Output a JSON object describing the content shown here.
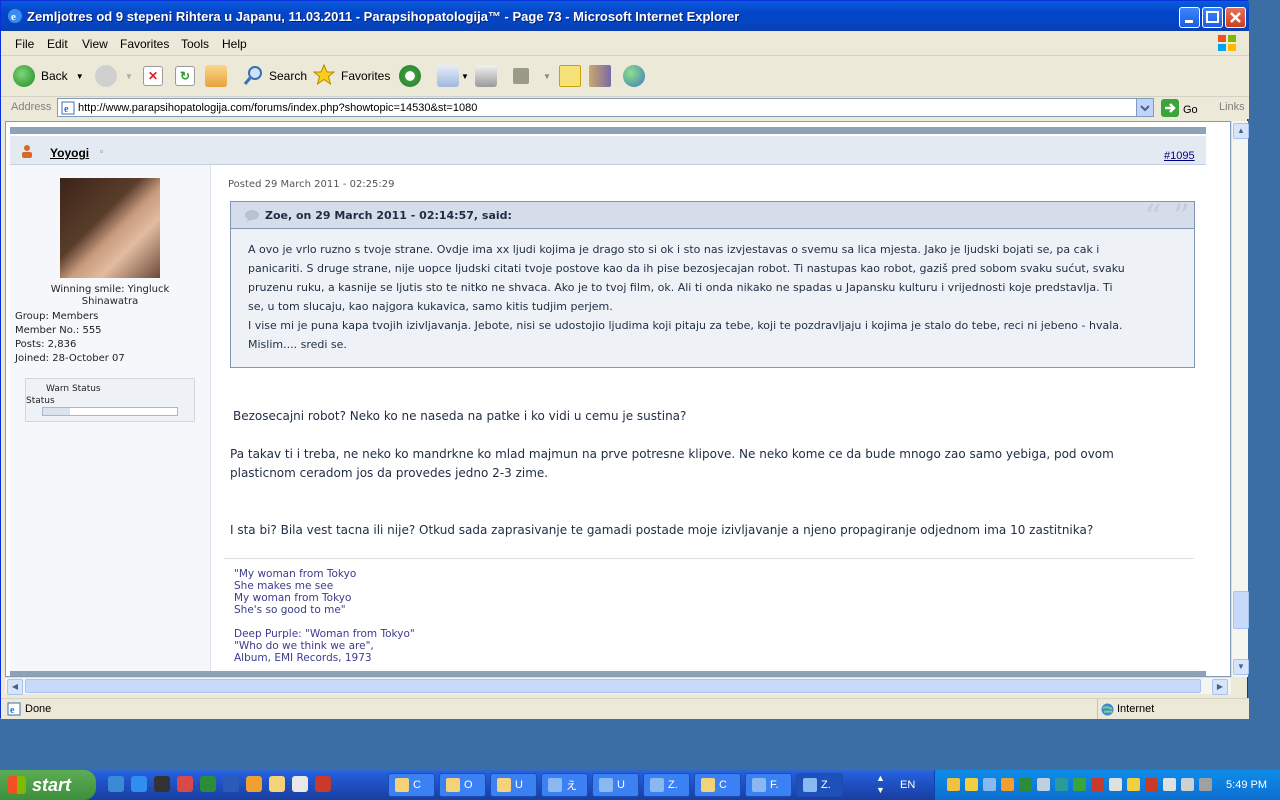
{
  "window": {
    "title": "Zemljotres od 9 stepeni Rihtera u Japanu, 11.03.2011 - Parapsihopatologija™ - Page 73 - Microsoft Internet Explorer"
  },
  "menu": [
    "File",
    "Edit",
    "View",
    "Favorites",
    "Tools",
    "Help"
  ],
  "toolbar": {
    "back": "Back",
    "search": "Search",
    "favorites": "Favorites"
  },
  "address": {
    "label": "Address",
    "url": "http://www.parapsihopatologija.com/forums/index.php?showtopic=14530&st=1080",
    "go": "Go",
    "links": "Links"
  },
  "post": {
    "username": "Yoyogi",
    "number": "#1095",
    "posted": "Posted 29 March 2011 - 02:25:29",
    "avatar_caption": "Winning smile: Yingluck Shinawatra",
    "group": "Group:  Members",
    "member_no": "Member No.:  555",
    "posts": "Posts:  2,836",
    "joined": "Joined:  28-October 07",
    "warn_label": "Warn Status",
    "status_label": "Status",
    "warn_level": 0.2,
    "quote_header": "Zoe, on 29 March 2011 - 02:14:57, said:",
    "quote_lines": [
      "A ovo je vrlo ruzno s tvoje strane. Ovdje ima xx ljudi kojima je drago sto si ok i sto nas izvjestavas o svemu sa lica mjesta. Jako je ljudski bojati se, pa cak i",
      "panicariti. S druge strane, nije uopce ljudski citati tvoje postove kao da ih pise bezosjecajan robot. Ti nastupas kao robot, gaziš pred sobom svaku sućut, svaku",
      "pruzenu ruku, a kasnije se ljutis sto te nitko ne shvaca. Ako je to tvoj film, ok. Ali ti onda nikako ne spadas u Japansku kulturu i vrijednosti koje predstavlja. Ti",
      "se, u tom slucaju, kao najgora kukavica, samo kitis tudjim perjem.",
      "I vise mi je puna kapa tvojih izivljavanja. Jebote, nisi se udostojio ljudima koji pitaju za tebe, koji te pozdravljaju i kojima je stalo do tebe, reci ni jebeno - hvala.",
      "Mislim.... sredi se."
    ],
    "body1": "Bezosecajni robot? Neko ko ne naseda na patke i ko vidi u cemu je sustina?",
    "body2a": "Pa takav ti i treba, ne neko ko mandrkne ko mlad majmun na prve potresne klipove. Ne neko kome ce da bude mnogo zao samo yebiga, pod ovom",
    "body2b": "plasticnom ceradom jos da provedes jedno 2-3 zime.",
    "body3": "I sta bi? Bila vest tacna ili nije? Otkud sada zaprasivanje te gamadi postade moje izivljavanje a njeno propagiranje odjednom ima 10 zastitnika?",
    "signature": [
      "\"My woman from Tokyo",
      "She makes me see",
      "My woman from Tokyo",
      "She's so good to me\"",
      "",
      "Deep Purple: \"Woman from Tokyo\"",
      "\"Who do we think we are\",",
      "Album, EMI Records, 1973"
    ]
  },
  "status": {
    "text": "Done",
    "zone": "Internet"
  },
  "taskbar": {
    "start": "start",
    "tasks": [
      "C",
      "O",
      "U",
      "え",
      "U",
      "Z.",
      "C",
      "F.",
      "Z."
    ],
    "lang": "EN",
    "clock": "5:49 PM"
  }
}
